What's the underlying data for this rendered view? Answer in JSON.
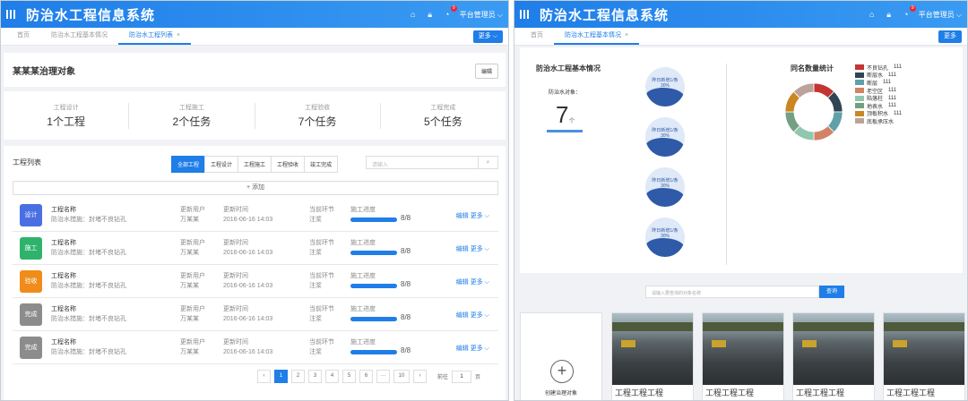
{
  "app": {
    "title": "防治水工程信息系统",
    "user": "平台管理员",
    "notif_count": "9"
  },
  "left": {
    "tabs": [
      "首页",
      "防治水工程基本情况",
      "防治水工程列表"
    ],
    "more_label": "更多",
    "object_title": "某某某治理对象",
    "edit_label": "编辑",
    "stats": [
      {
        "label": "工程设计",
        "value": "1个工程"
      },
      {
        "label": "工程施工",
        "value": "2个任务"
      },
      {
        "label": "工程验收",
        "value": "7个任务"
      },
      {
        "label": "工程完成",
        "value": "5个任务"
      }
    ],
    "list_title": "工程列表",
    "filters": [
      "全部工程",
      "工程设计",
      "工程施工",
      "工程验收",
      "竣工完成"
    ],
    "search_placeholder": "请输入",
    "add_label": "+ 添加",
    "rows": [
      {
        "tag": "设计",
        "color": "#4a6fe3",
        "name_k": "工程名称",
        "name_v": "防治水措施：封堵不良钻孔",
        "user_k": "更新用户",
        "user_v": "万某某",
        "time_k": "更新时间",
        "time_v": "2016-06-16 14:03",
        "stage_k": "当前环节",
        "stage_v": "注浆",
        "prog_k": "施工进度",
        "prog_v": "8/8",
        "edit": "编辑",
        "more": "更多 ⌵"
      },
      {
        "tag": "施工",
        "color": "#2fb36c",
        "name_k": "工程名称",
        "name_v": "防治水措施：封堵不良钻孔",
        "user_k": "更新用户",
        "user_v": "万某某",
        "time_k": "更新时间",
        "time_v": "2016-06-16 14:03",
        "stage_k": "当前环节",
        "stage_v": "注浆",
        "prog_k": "施工进度",
        "prog_v": "8/8",
        "edit": "编辑",
        "more": "更多 ⌵"
      },
      {
        "tag": "验收",
        "color": "#f08c1a",
        "name_k": "工程名称",
        "name_v": "防治水措施：封堵不良钻孔",
        "user_k": "更新用户",
        "user_v": "万某某",
        "time_k": "更新时间",
        "time_v": "2016-06-16 14:03",
        "stage_k": "当前环节",
        "stage_v": "注浆",
        "prog_k": "施工进度",
        "prog_v": "8/8",
        "edit": "编辑",
        "more": "更多 ⌵"
      },
      {
        "tag": "完成",
        "color": "#8c8c8c",
        "name_k": "工程名称",
        "name_v": "防治水措施：封堵不良钻孔",
        "user_k": "更新用户",
        "user_v": "万某某",
        "time_k": "更新时间",
        "time_v": "2016-06-16 14:03",
        "stage_k": "当前环节",
        "stage_v": "注浆",
        "prog_k": "施工进度",
        "prog_v": "8/8",
        "edit": "编辑",
        "more": "更多 ⌵"
      },
      {
        "tag": "完成",
        "color": "#8c8c8c",
        "name_k": "工程名称",
        "name_v": "防治水措施：封堵不良钻孔",
        "user_k": "更新用户",
        "user_v": "万某某",
        "time_k": "更新时间",
        "time_v": "2016-06-16 14:03",
        "stage_k": "当前环节",
        "stage_v": "注浆",
        "prog_k": "施工进度",
        "prog_v": "8/8",
        "edit": "编辑",
        "more": "更多 ⌵"
      }
    ],
    "pagination": {
      "prev": "‹",
      "pages": [
        "1",
        "2",
        "3",
        "4",
        "5",
        "6",
        "···",
        "10"
      ],
      "next": "›",
      "goto": "前往",
      "page_value": "1",
      "page_suffix": "页"
    }
  },
  "right": {
    "tabs": [
      "首页",
      "防治水工程基本情况"
    ],
    "more_label": "更多",
    "basic_title": "防治水工程基本情况",
    "obj_label": "防治水对象：",
    "obj_count": "7",
    "obj_unit": "个",
    "circle_line1": "昨日新增1/条",
    "circle_line2": "30%",
    "stat_title": "同名数量统计",
    "legend": [
      {
        "name": "不良钻孔",
        "count": "111",
        "color": "#c23531"
      },
      {
        "name": "断层水",
        "count": "111",
        "color": "#2f4554"
      },
      {
        "name": "断层",
        "count": "111",
        "color": "#61a0a8"
      },
      {
        "name": "老空区",
        "count": "111",
        "color": "#d48265"
      },
      {
        "name": "陷落柱",
        "count": "111",
        "color": "#91c7ae"
      },
      {
        "name": "地表水",
        "count": "111",
        "color": "#749f83"
      },
      {
        "name": "顶板积水",
        "count": "111",
        "color": "#ca8622"
      },
      {
        "name": "底板承压水",
        "count": "",
        "color": "#bda29a"
      }
    ],
    "search_placeholder": "请输入要查询的对象名称",
    "query_label": "查询",
    "create_label": "创建治理对象",
    "card_title": "工程工程工程"
  }
}
